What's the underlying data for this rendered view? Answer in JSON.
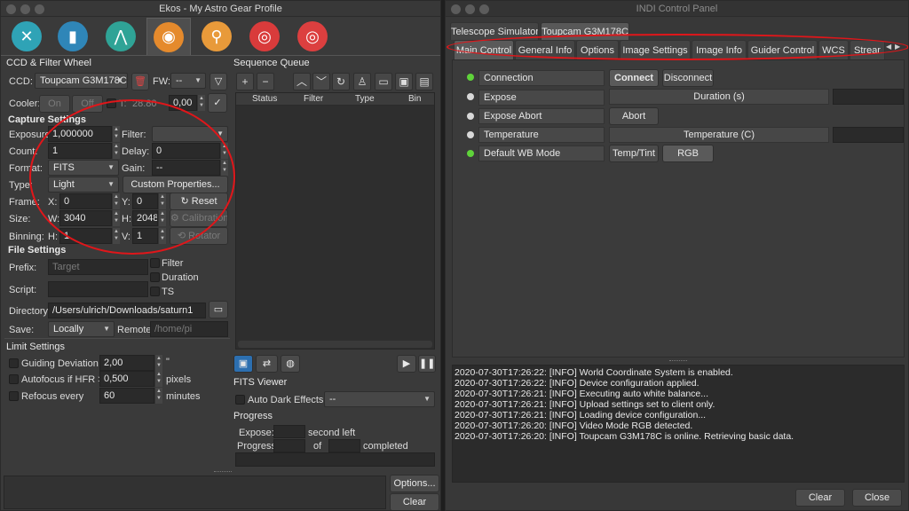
{
  "ekos": {
    "title": "Ekos - My Astro Gear Profile",
    "module_icons": [
      "wrench-screwdriver-icon",
      "book-icon",
      "tripod-icon",
      "camera-icon",
      "magnifier-icon",
      "target-icon",
      "bullseye-icon"
    ],
    "ccd_section": "CCD & Filter Wheel",
    "ccd_label": "CCD:",
    "ccd_value": "Toupcam G3M178C",
    "fw_label": "FW:",
    "fw_value": "--",
    "cooler_label": "Cooler:",
    "cooler_on": "On",
    "cooler_off": "Off",
    "ts_label": "T:",
    "ts_value": "28.80",
    "cooler_set": "0,00",
    "capture_section": "Capture Settings",
    "exposure_label": "Exposure:",
    "exposure_value": "1,000000",
    "filter_label": "Filter:",
    "filter_value": "",
    "count_label": "Count:",
    "count_value": "1",
    "delay_label": "Delay:",
    "delay_value": "0",
    "format_label": "Format:",
    "format_value": "FITS",
    "gain_label": "Gain:",
    "gain_value": "--",
    "type_label": "Type:",
    "type_value": "Light",
    "custom_props": "Custom Properties...",
    "frame_label": "Frame:",
    "x_label": "X:",
    "x_value": "0",
    "y_label": "Y:",
    "y_value": "0",
    "reset": "Reset",
    "size_label": "Size:",
    "w_label": "W:",
    "w_value": "3040",
    "h_label": "H:",
    "h_value": "2048",
    "calibration": "Calibration",
    "binning_label": "Binning:",
    "binh_label": "H:",
    "binh_value": "1",
    "binv_label": "V:",
    "binv_value": "1",
    "rotator": "Rotator",
    "file_section": "File Settings",
    "prefix_label": "Prefix:",
    "prefix_placeholder": "Target",
    "opt_filter": "Filter",
    "opt_duration": "Duration",
    "opt_ts": "TS",
    "script_label": "Script:",
    "directory_label": "Directory:",
    "directory_value": "/Users/ulrich/Downloads/saturn1",
    "save_label": "Save:",
    "save_value": "Locally",
    "remote_label": "Remote:",
    "remote_placeholder": "/home/pi",
    "limit_section": "Limit Settings",
    "guiding_label": "Guiding Deviation <",
    "guiding_value": "2,00",
    "guiding_unit": "\"",
    "autofocus_label": "Autofocus if HFR >",
    "autofocus_value": "0,500",
    "autofocus_unit": "pixels",
    "refocus_label": "Refocus every",
    "refocus_value": "60",
    "refocus_unit": "minutes",
    "queue_section": "Sequence Queue",
    "queue_columns": [
      "Status",
      "Filter",
      "Type",
      "Bin"
    ],
    "fits_viewer": "FITS Viewer",
    "auto_dark": "Auto Dark",
    "effects_label": "Effects:",
    "effects_value": "--",
    "progress_section": "Progress",
    "expose_label": "Expose:",
    "second_left": "second left",
    "progress_label": "Progress:",
    "of_label": "of",
    "completed_label": "completed",
    "options_btn": "Options...",
    "clear_btn": "Clear"
  },
  "indi": {
    "title": "INDI Control Panel",
    "device_tabs": [
      "Telescope Simulator",
      "Toupcam G3M178C"
    ],
    "group_tabs": [
      "Main Control",
      "General Info",
      "Options",
      "Image Settings",
      "Image Info",
      "Guider Control",
      "WCS",
      "Strear"
    ],
    "props": [
      {
        "name": "Connection",
        "led": "#5fd33a",
        "btn1": "Connect",
        "btn2": "Disconnect"
      },
      {
        "name": "Expose",
        "led": "#d8d8d8",
        "field": "Duration (s)"
      },
      {
        "name": "Expose Abort",
        "led": "#d8d8d8",
        "btn1": "Abort"
      },
      {
        "name": "Temperature",
        "led": "#d8d8d8",
        "field": "Temperature (C)"
      },
      {
        "name": "Default WB Mode",
        "led": "#5fd33a",
        "btn1": "Temp/Tint",
        "btn2": "RGB"
      }
    ],
    "log": [
      "2020-07-30T17:26:22: [INFO] World Coordinate System is enabled.",
      "2020-07-30T17:26:22: [INFO] Device configuration applied.",
      "2020-07-30T17:26:21: [INFO] Executing auto white balance...",
      "2020-07-30T17:26:21: [INFO] Upload settings set to client only.",
      "2020-07-30T17:26:21: [INFO] Loading device configuration...",
      "2020-07-30T17:26:20: [INFO] Video Mode RGB detected.",
      "2020-07-30T17:26:20: [INFO] Toupcam G3M178C is online. Retrieving basic data."
    ],
    "clear_btn": "Clear",
    "close_btn": "Close"
  },
  "colors": {
    "annotation": "#e0161a",
    "led_ok": "#5fd33a",
    "led_idle": "#d8d8d8"
  }
}
